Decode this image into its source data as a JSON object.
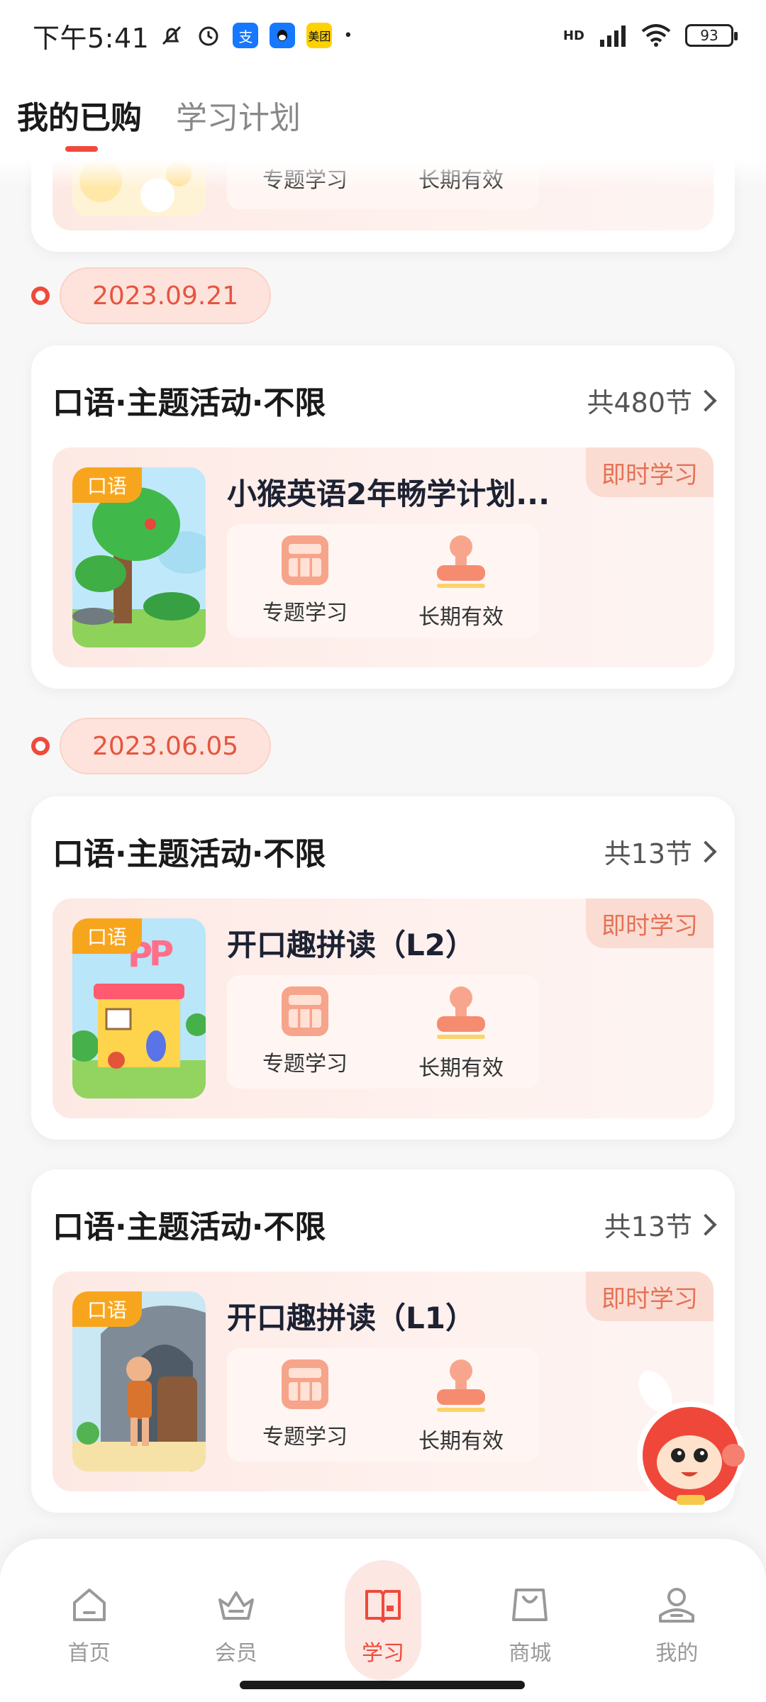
{
  "status_bar": {
    "time": "下午5:41",
    "app_icons": [
      "alipay-icon",
      "qq-icon",
      "meituan-icon"
    ],
    "meituan_label": "美团",
    "alipay_label": "支",
    "network": "HD",
    "battery": "93"
  },
  "tabs": [
    {
      "label": "我的已购",
      "active": true
    },
    {
      "label": "学习计划",
      "active": false
    }
  ],
  "partial_card": {
    "feature_1": "专题学习",
    "feature_2": "长期有效"
  },
  "groups": [
    {
      "date": "2023.09.21",
      "cards": [
        {
          "title": "口语·主题活动·不限",
          "count": "共480节",
          "badge": "即时学习",
          "tag": "口语",
          "name": "小猴英语2年畅学计划...",
          "features": [
            "专题学习",
            "长期有效"
          ]
        }
      ]
    },
    {
      "date": "2023.06.05",
      "cards": [
        {
          "title": "口语·主题活动·不限",
          "count": "共13节",
          "badge": "即时学习",
          "tag": "口语",
          "name": "开口趣拼读（L2）",
          "features": [
            "专题学习",
            "长期有效"
          ]
        },
        {
          "title": "口语·主题活动·不限",
          "count": "共13节",
          "badge": "即时学习",
          "tag": "口语",
          "name": "开口趣拼读（L1）",
          "features": [
            "专题学习",
            "长期有效"
          ]
        }
      ]
    }
  ],
  "bottom_nav": [
    {
      "label": "首页",
      "icon": "home-icon",
      "active": false
    },
    {
      "label": "会员",
      "icon": "crown-icon",
      "active": false
    },
    {
      "label": "学习",
      "icon": "book-icon",
      "active": true
    },
    {
      "label": "商城",
      "icon": "shopping-bag-icon",
      "active": false
    },
    {
      "label": "我的",
      "icon": "profile-icon",
      "active": false
    }
  ],
  "colors": {
    "accent": "#ef4a3c",
    "badge_text": "#e57256",
    "tag_bg": "#f8a51e"
  }
}
